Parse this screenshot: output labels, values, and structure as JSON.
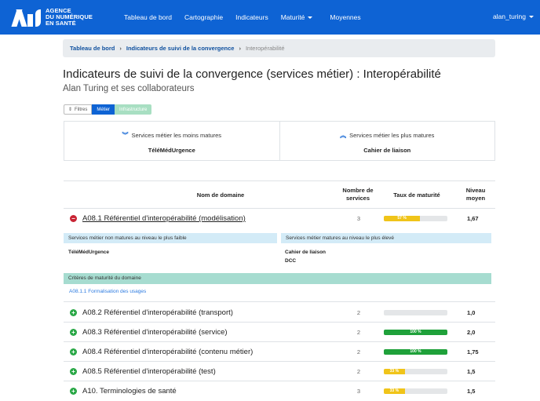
{
  "nav": {
    "logo_lines": [
      "AGENCE",
      "DU NUMÉRIQUE",
      "EN SANTÉ"
    ],
    "items": [
      "Tableau de bord",
      "Cartographie",
      "Indicateurs",
      "Maturité",
      "Moyennes"
    ],
    "user": "alan_turing"
  },
  "breadcrumb": {
    "items": [
      "Tableau de bord",
      "Indicateurs de suivi de la convergence"
    ],
    "active": "Interopérabilité"
  },
  "page": {
    "title": "Indicateurs de suivi de la convergence (services métier) : Interopérabilité",
    "subtitle": "Alan Turing et ses collaborateurs"
  },
  "filters": {
    "filtres_label": "Filtres",
    "metier_label": "Métier",
    "infra_label": "Infrastructure"
  },
  "summary": {
    "least": {
      "label": "Services métier les moins matures",
      "value": "TéléMédUrgence"
    },
    "most": {
      "label": "Services métier les plus matures",
      "value": "Cahier de liaison"
    }
  },
  "table": {
    "headers": {
      "domain": "Nom de domaine",
      "count_line1": "Nombre de",
      "count_line2": "services",
      "rate": "Taux de maturité",
      "avg_line1": "Niveau",
      "avg_line2": "moyen"
    },
    "rows": [
      {
        "name": "A08.1 Référentiel d'interopérabilité (modélisation)",
        "count": "3",
        "percent": 57,
        "percent_label": "57 %",
        "color": "#f0c419",
        "avg": "1,67",
        "expanded": true
      },
      {
        "name": "A08.2 Référentiel d'interopérabilité (transport)",
        "count": "2",
        "percent": 0,
        "percent_label": "",
        "color": "#f0c419",
        "avg": "1,0",
        "expanded": false
      },
      {
        "name": "A08.3 Référentiel d'interopérabilité (service)",
        "count": "2",
        "percent": 100,
        "percent_label": "100 %",
        "color": "#1fa13a",
        "avg": "2,0",
        "expanded": false
      },
      {
        "name": "A08.4 Référentiel d'interopérabilité (contenu métier)",
        "count": "2",
        "percent": 100,
        "percent_label": "100 %",
        "color": "#1fa13a",
        "avg": "1,75",
        "expanded": false
      },
      {
        "name": "A08.5 Référentiel d'interopérabilité (test)",
        "count": "2",
        "percent": 33,
        "percent_label": "33 %",
        "color": "#f0c419",
        "avg": "1,5",
        "expanded": false
      },
      {
        "name": "A10. Terminologies de santé",
        "count": "3",
        "percent": 33,
        "percent_label": "33 %",
        "color": "#f0c419",
        "avg": "1,5",
        "expanded": false
      }
    ]
  },
  "detail": {
    "non_mature_head": "Services métier non matures au niveau le plus faible",
    "non_mature_items": [
      "TéléMédUrgence"
    ],
    "mature_head": "Services métier matures au niveau le plus élevé",
    "mature_items": [
      "Cahier de liaison",
      "DCC"
    ],
    "criteria_head": "Critères de maturité du domaine",
    "criteria_link": "A08.1.1 Formalisation des usages"
  }
}
